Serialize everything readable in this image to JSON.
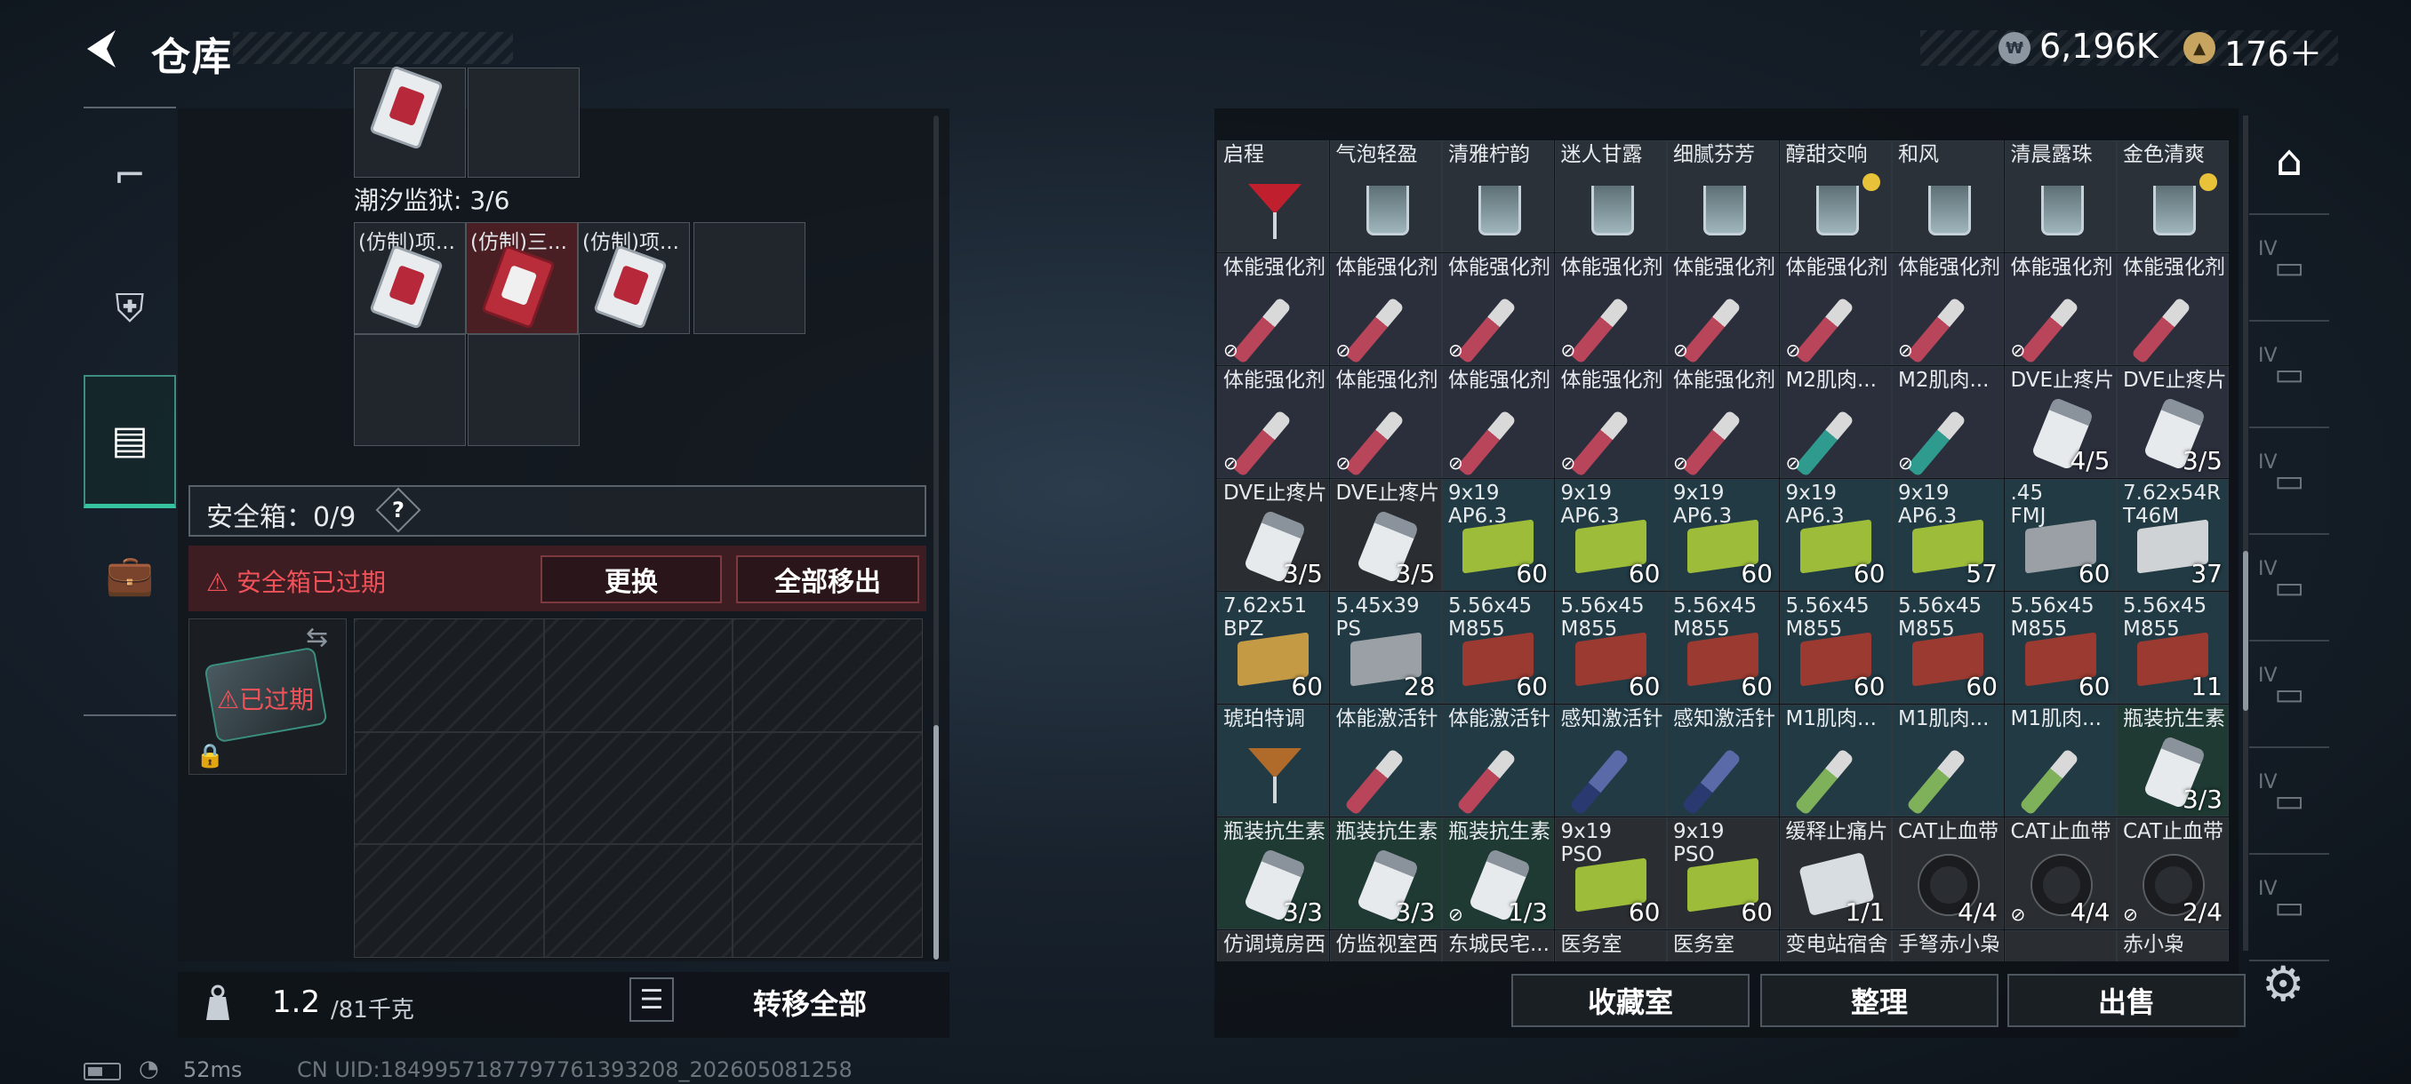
{
  "header": {
    "title": "仓库"
  },
  "currency": {
    "coin1": "6,196K",
    "coin2": "176＋",
    "coin1_symbol": "₩",
    "coin2_symbol": "▲"
  },
  "left": {
    "prison_label": "潮汐监狱: 3/6",
    "prison_items": [
      {
        "name": "(仿制)项...",
        "highlight": false
      },
      {
        "name": "(仿制)三...",
        "highlight": true
      },
      {
        "name": "(仿制)项...",
        "highlight": false
      }
    ],
    "safebox_label": "安全箱：0/9",
    "help": "?",
    "warning": "安全箱已过期",
    "replace_label": "更换",
    "moveall_label": "全部移出",
    "case_status": "已过期",
    "weight_value": "1.2",
    "weight_max": "/81千克",
    "transfer_label": "转移全部"
  },
  "status": {
    "ping": "52ms",
    "uid": "CN UID:1849957187797761393208_202605081258"
  },
  "grid": {
    "rows": [
      [
        {
          "n": "启程",
          "t": "martini",
          "bg": "drink"
        },
        {
          "n": "气泡轻盈",
          "t": "glass",
          "bg": "drink"
        },
        {
          "n": "清雅柠韵",
          "t": "glass",
          "bg": "drink"
        },
        {
          "n": "迷人甘露",
          "t": "glass",
          "bg": "drink"
        },
        {
          "n": "细腻芬芳",
          "t": "glass",
          "bg": "drink"
        },
        {
          "n": "醇甜交响",
          "t": "glass",
          "bg": "drink",
          "dot": true
        },
        {
          "n": "和风",
          "t": "glass",
          "bg": "drink"
        },
        {
          "n": "清晨露珠",
          "t": "glass",
          "bg": "drink"
        },
        {
          "n": "金色清爽",
          "t": "glass",
          "bg": "drink",
          "dot": true
        }
      ],
      [
        {
          "n": "体能强化剂",
          "t": "syr-pink",
          "bg": "syr",
          "nf": true
        },
        {
          "n": "体能强化剂",
          "t": "syr-pink",
          "bg": "syr",
          "nf": true
        },
        {
          "n": "体能强化剂",
          "t": "syr-pink",
          "bg": "syr",
          "nf": true
        },
        {
          "n": "体能强化剂",
          "t": "syr-pink",
          "bg": "syr",
          "nf": true
        },
        {
          "n": "体能强化剂",
          "t": "syr-pink",
          "bg": "syr",
          "nf": true
        },
        {
          "n": "体能强化剂",
          "t": "syr-pink",
          "bg": "syr",
          "nf": true
        },
        {
          "n": "体能强化剂",
          "t": "syr-pink",
          "bg": "syr",
          "nf": true
        },
        {
          "n": "体能强化剂",
          "t": "syr-pink",
          "bg": "syr",
          "nf": true
        },
        {
          "n": "体能强化剂",
          "t": "syr-pink",
          "bg": "syr"
        }
      ],
      [
        {
          "n": "体能强化剂",
          "t": "syr-pink",
          "bg": "syr",
          "nf": true
        },
        {
          "n": "体能强化剂",
          "t": "syr-pink",
          "bg": "syr",
          "nf": true
        },
        {
          "n": "体能强化剂",
          "t": "syr-pink",
          "bg": "syr",
          "nf": true
        },
        {
          "n": "体能强化剂",
          "t": "syr-pink",
          "bg": "syr",
          "nf": true
        },
        {
          "n": "体能强化剂",
          "t": "syr-pink",
          "bg": "syr",
          "nf": true
        },
        {
          "n": "M2肌肉...",
          "t": "syr-teal",
          "bg": "syr",
          "nf": true
        },
        {
          "n": "M2肌肉...",
          "t": "syr-teal",
          "bg": "syr",
          "nf": true
        },
        {
          "n": "DVE止疼片",
          "t": "pill",
          "bg": "syr",
          "c": "4/5"
        },
        {
          "n": "DVE止疼片",
          "t": "pill",
          "bg": "syr",
          "c": "3/5"
        }
      ],
      [
        {
          "n": "DVE止疼片",
          "t": "pill",
          "bg": "gray",
          "c": "3/5"
        },
        {
          "n": "DVE止疼片",
          "t": "pill",
          "bg": "gray",
          "c": "3/5"
        },
        {
          "n": "9x19\nAP6.3",
          "t": "box-green",
          "bg": "ammo",
          "c": "60"
        },
        {
          "n": "9x19\nAP6.3",
          "t": "box-green",
          "bg": "ammo",
          "c": "60"
        },
        {
          "n": "9x19\nAP6.3",
          "t": "box-green",
          "bg": "ammo",
          "c": "60"
        },
        {
          "n": "9x19\nAP6.3",
          "t": "box-green",
          "bg": "ammo",
          "c": "60"
        },
        {
          "n": "9x19\nAP6.3",
          "t": "box-green",
          "bg": "ammo",
          "c": "57"
        },
        {
          "n": ".45\nFMJ",
          "t": "box-gray",
          "bg": "ammo",
          "c": "60"
        },
        {
          "n": "7.62x54R\nT46M",
          "t": "box-light",
          "bg": "ammo",
          "c": "37"
        }
      ],
      [
        {
          "n": "7.62x51\nBPZ",
          "t": "box-tan",
          "bg": "ammo",
          "c": "60"
        },
        {
          "n": "5.45x39\nPS",
          "t": "box-gray",
          "bg": "ammo",
          "c": "28"
        },
        {
          "n": "5.56x45\nM855",
          "t": "box-red",
          "bg": "ammo",
          "c": "60"
        },
        {
          "n": "5.56x45\nM855",
          "t": "box-red",
          "bg": "ammo",
          "c": "60"
        },
        {
          "n": "5.56x45\nM855",
          "t": "box-red",
          "bg": "ammo",
          "c": "60"
        },
        {
          "n": "5.56x45\nM855",
          "t": "box-red",
          "bg": "ammo",
          "c": "60"
        },
        {
          "n": "5.56x45\nM855",
          "t": "box-red",
          "bg": "ammo",
          "c": "60"
        },
        {
          "n": "5.56x45\nM855",
          "t": "box-red",
          "bg": "ammo",
          "c": "60"
        },
        {
          "n": "5.56x45\nM855",
          "t": "box-red",
          "bg": "ammo",
          "c": "11"
        }
      ],
      [
        {
          "n": "琥珀特调",
          "t": "martini-amber",
          "bg": "ammo"
        },
        {
          "n": "体能激活针",
          "t": "syr-pink",
          "bg": "ammo"
        },
        {
          "n": "体能激活针",
          "t": "syr-pink",
          "bg": "ammo"
        },
        {
          "n": "感知激活针",
          "t": "syr-blue",
          "bg": "ammo"
        },
        {
          "n": "感知激活针",
          "t": "syr-blue",
          "bg": "ammo"
        },
        {
          "n": "M1肌肉...",
          "t": "syr-lime",
          "bg": "ammo"
        },
        {
          "n": "M1肌肉...",
          "t": "syr-lime",
          "bg": "ammo"
        },
        {
          "n": "M1肌肉...",
          "t": "syr-lime",
          "bg": "ammo"
        },
        {
          "n": "瓶装抗生素",
          "t": "bottle",
          "bg": "green",
          "c": "3/3"
        }
      ],
      [
        {
          "n": "瓶装抗生素",
          "t": "bottle",
          "bg": "green",
          "c": "3/3"
        },
        {
          "n": "瓶装抗生素",
          "t": "bottle",
          "bg": "green",
          "c": "3/3"
        },
        {
          "n": "瓶装抗生素",
          "t": "bottle",
          "bg": "green",
          "c": "1/3",
          "nf": true
        },
        {
          "n": "9x19\nPSO",
          "t": "box-green",
          "bg": "gray",
          "c": "60"
        },
        {
          "n": "9x19\nPSO",
          "t": "box-green",
          "bg": "gray",
          "c": "60"
        },
        {
          "n": "缓释止痛片",
          "t": "blister",
          "bg": "gray",
          "c": "1/1"
        },
        {
          "n": "CAT止血带",
          "t": "tq",
          "bg": "gray",
          "c": "4/4"
        },
        {
          "n": "CAT止血带",
          "t": "tq",
          "bg": "gray",
          "c": "4/4",
          "nf": true
        },
        {
          "n": "CAT止血带",
          "t": "tq",
          "bg": "gray",
          "c": "2/4",
          "nf": true
        }
      ],
      [
        {
          "n": "仿调境房西",
          "t": "none",
          "bg": "gray"
        },
        {
          "n": "仿监视室西",
          "t": "none",
          "bg": "gray"
        },
        {
          "n": "东城民宅...",
          "t": "none",
          "bg": "gray"
        },
        {
          "n": "医务室",
          "t": "none",
          "bg": "gray"
        },
        {
          "n": "医务室",
          "t": "none",
          "bg": "gray"
        },
        {
          "n": "变电站宿舍",
          "t": "none",
          "bg": "gray"
        },
        {
          "n": "手弩赤小枭",
          "t": "none",
          "bg": "gray"
        },
        {
          "n": "",
          "t": "none",
          "bg": "gray"
        },
        {
          "n": "赤小枭",
          "t": "none",
          "bg": "gray"
        }
      ]
    ]
  },
  "buttons": {
    "collect": "收藏室",
    "sort": "整理",
    "sell": "出售"
  },
  "right_rail": {
    "tags": [
      "",
      "IV",
      "IV",
      "IV",
      "IV",
      "IV",
      "IV",
      "IV"
    ]
  }
}
